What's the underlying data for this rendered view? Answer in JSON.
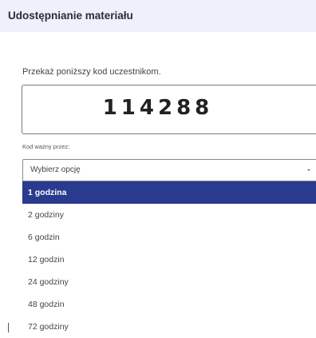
{
  "header": {
    "title": "Udostępnianie materiału"
  },
  "instruction": "Przekaż poniższy kod uczestnikom.",
  "code": "114288",
  "select": {
    "label": "Kod ważny przez:",
    "value": "Wybierz opcję",
    "options": [
      "1 godzina",
      "2 godziny",
      "6 godzin",
      "12 godzin",
      "24 godziny",
      "48 godzin",
      "72 godziny"
    ],
    "highlighted_index": 0
  },
  "colors": {
    "header_bg": "#eef0fc",
    "highlight": "#2a3a8f"
  }
}
